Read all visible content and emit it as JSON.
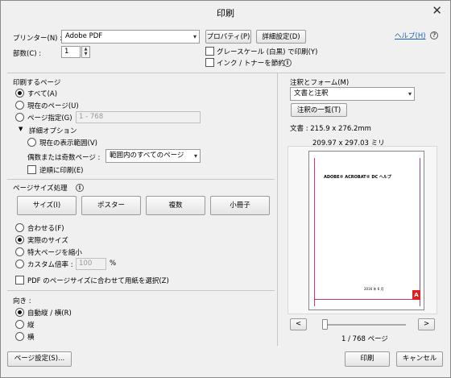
{
  "window": {
    "title": "印刷",
    "close_glyph": "✕"
  },
  "printer": {
    "label": "プリンター(N) :",
    "selected": "Adobe PDF",
    "properties_button": "プロパティ(P)",
    "advanced_button": "詳細設定(D)",
    "help_link": "ヘルプ(H)",
    "copies_label": "部数(C) :",
    "copies_value": "1",
    "grayscale_label": "グレースケール (白黒) で印刷(Y)",
    "save_ink_label": "インク / トナーを節約"
  },
  "pages_to_print": {
    "heading": "印刷するページ",
    "all": "すべて(A)",
    "current": "現在のページ(U)",
    "range": "ページ指定(G)",
    "range_placeholder": "1 - 768",
    "more_options": "詳細オプション",
    "current_view": "現在の表示範囲(V)",
    "odd_even_label": "偶数または奇数ページ :",
    "odd_even_selected": "範囲内のすべてのページ",
    "reverse": "逆順に印刷(E)"
  },
  "page_sizing": {
    "heading": "ページサイズ処理",
    "tabs": [
      "サイズ(I)",
      "ポスター",
      "複数",
      "小冊子"
    ],
    "fit": "合わせる(F)",
    "actual": "実際のサイズ",
    "shrink": "特大ページを縮小",
    "custom": "カスタム倍率 :",
    "custom_value": "100",
    "percent": "%",
    "choose_paper": "PDF のページサイズに合わせて用紙を選択(Z)"
  },
  "orientation": {
    "heading": "向き :",
    "auto": "自動縦 / 横(R)",
    "portrait": "縦",
    "landscape": "横"
  },
  "comments": {
    "heading": "注釈とフォーム(M)",
    "selected": "文書と注釈",
    "summarize_button": "注釈の一覧(T)"
  },
  "preview": {
    "document_size": "文書 : 215.9 x 276.2mm",
    "paper_size": "209.97 x 297.03 ミリ",
    "page_heading": "ADOBE® ACROBAT® DC ヘルプ",
    "page_footer": "2016 年 6 月",
    "adobe_logo": "A",
    "prev": "<",
    "next": ">",
    "page_counter": "1 / 768 ページ",
    "slider_position": 0.0
  },
  "footer": {
    "page_setup": "ページ設定(S)...",
    "print": "印刷",
    "cancel": "キャンセル"
  }
}
